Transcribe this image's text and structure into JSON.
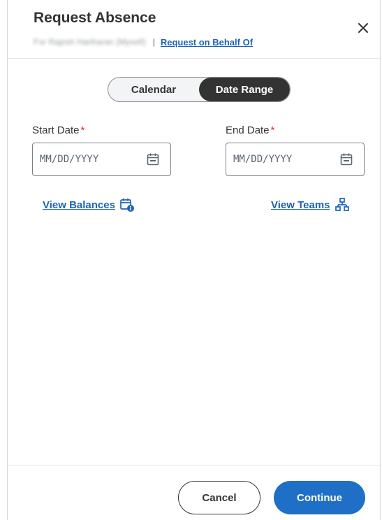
{
  "dialog": {
    "title": "Request Absence",
    "subtitle_name": "For Rajesh Hariharan (Myself)",
    "separator": "|",
    "behalf_link": "Request on Behalf Of"
  },
  "toggle": {
    "options": [
      "Calendar",
      "Date Range"
    ],
    "selected": "Date Range"
  },
  "start_date": {
    "label": "Start Date",
    "required_mark": "*",
    "placeholder": "MM/DD/YYYY",
    "icon": "calendar-icon"
  },
  "end_date": {
    "label": "End Date",
    "required_mark": "*",
    "placeholder": "MM/DD/YYYY",
    "icon": "calendar-icon"
  },
  "links": {
    "view_balances": "View Balances",
    "view_balances_icon": "calendar-info-icon",
    "view_teams": "View Teams",
    "view_teams_icon": "org-chart-icon"
  },
  "footer": {
    "cancel": "Cancel",
    "continue": "Continue"
  },
  "colors": {
    "link": "#1d63b8",
    "primary": "#1f6fc6",
    "required": "#de2e21",
    "toggle_active": "#333333"
  }
}
